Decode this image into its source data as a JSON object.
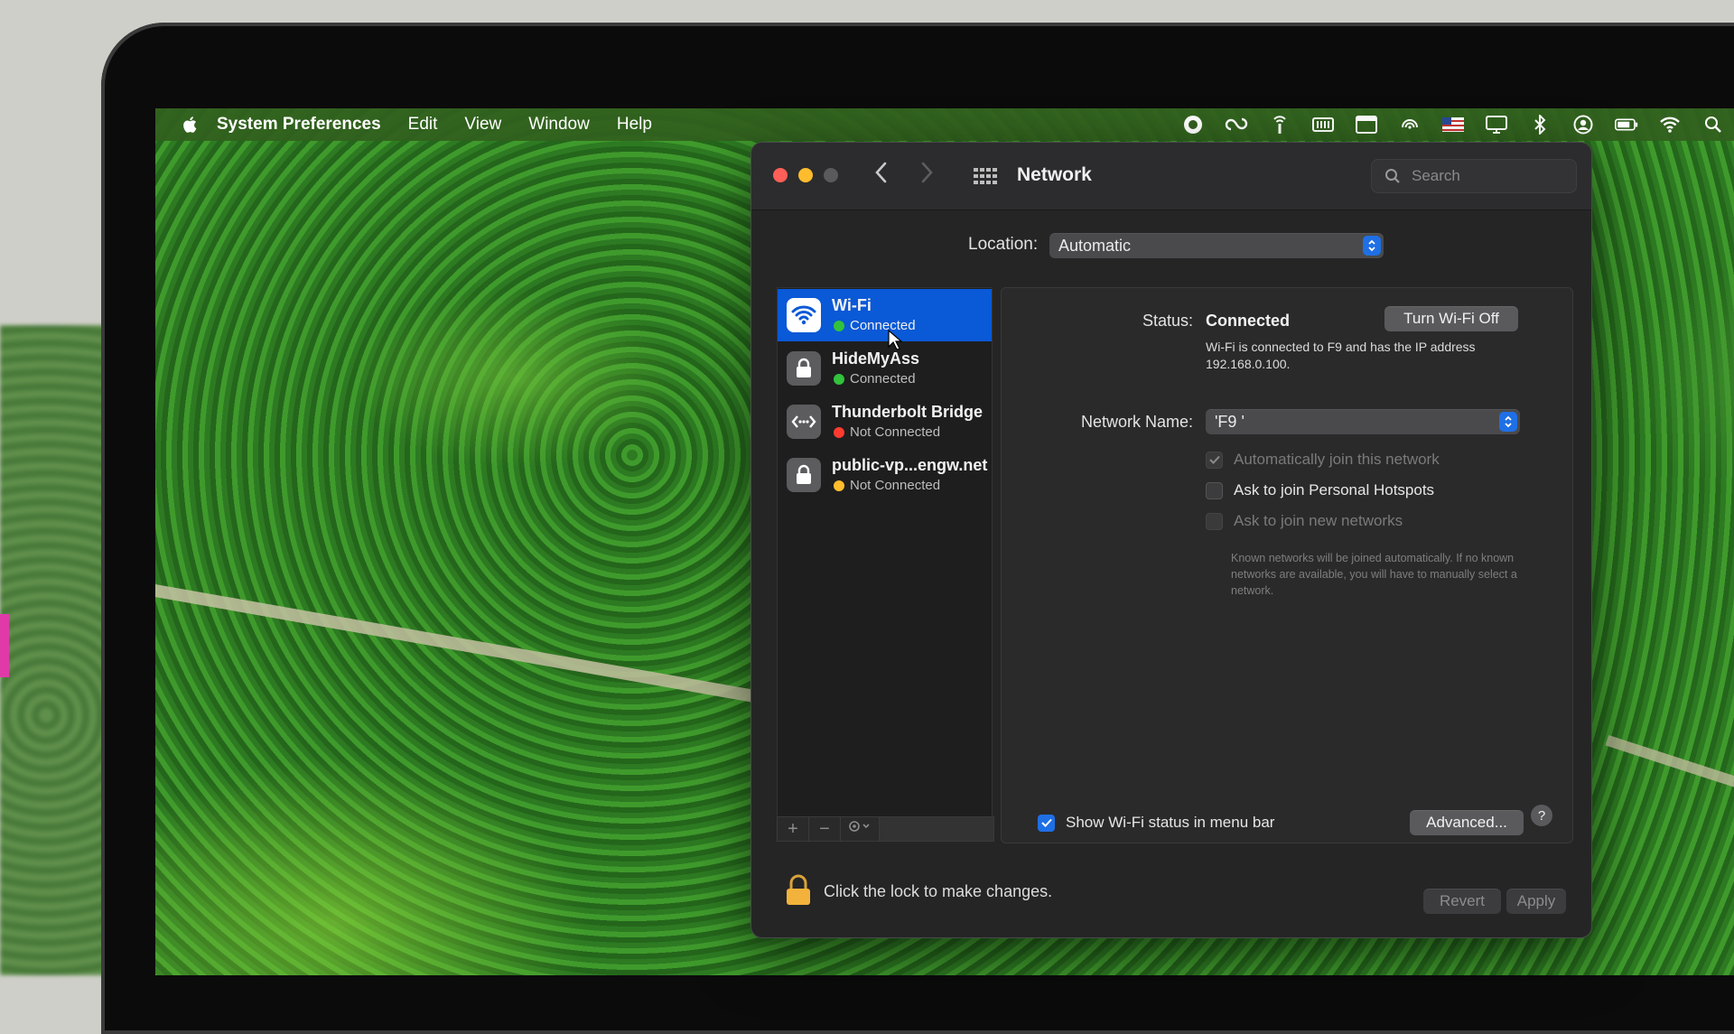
{
  "menubar": {
    "app_name": "System Preferences",
    "items": [
      "Edit",
      "View",
      "Window",
      "Help"
    ]
  },
  "window": {
    "title": "Network",
    "search_placeholder": "Search",
    "location": {
      "label": "Location:",
      "value": "Automatic"
    },
    "services": [
      {
        "name": "Wi-Fi",
        "status": "Connected",
        "status_color": "#32c23c",
        "selected": true,
        "icon": "wifi-icon"
      },
      {
        "name": "HideMyAss",
        "status": "Connected",
        "status_color": "#32c23c",
        "selected": false,
        "icon": "lock-icon"
      },
      {
        "name": "Thunderbolt Bridge",
        "status": "Not Connected",
        "status_color": "#ff3b30",
        "selected": false,
        "icon": "thunderbolt-bridge-icon"
      },
      {
        "name": "public-vp...engw.net",
        "status": "Not Connected",
        "status_color": "#ffbd2e",
        "selected": false,
        "icon": "lock-icon"
      }
    ],
    "detail": {
      "status_label": "Status:",
      "status_value": "Connected",
      "turn_off_button": "Turn Wi-Fi Off",
      "description": "Wi-Fi is connected to F9  and has the IP address 192.168.0.100.",
      "network_name_label": "Network Name:",
      "network_name_value": "'F9 '",
      "auto_join": {
        "label": "Automatically join this network",
        "checked": true,
        "enabled": false
      },
      "personal_hotspots": {
        "label": "Ask to join Personal Hotspots",
        "checked": false,
        "enabled": true
      },
      "new_networks": {
        "label": "Ask to join new networks",
        "checked": false,
        "enabled": false
      },
      "hint": "Known networks will be joined automatically. If no known networks are available, you will have to manually select a network.",
      "show_status": {
        "label": "Show Wi-Fi status in menu bar",
        "checked": true
      },
      "advanced_button": "Advanced...",
      "help_button": "?"
    },
    "footer": {
      "lock_text": "Click the lock to make changes.",
      "revert_button": "Revert",
      "apply_button": "Apply"
    }
  }
}
